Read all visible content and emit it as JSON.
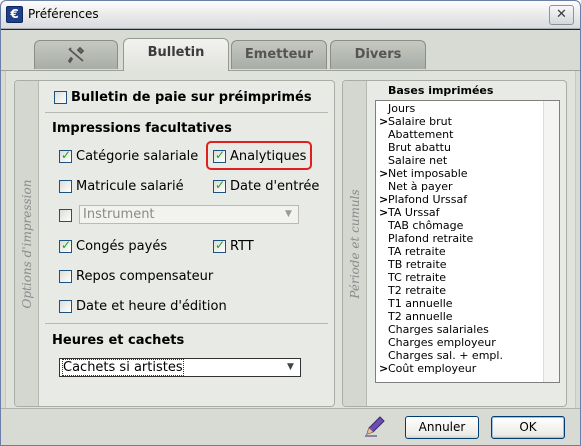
{
  "window": {
    "title": "Préférences",
    "close_glyph": "✕",
    "app_icon_glyph": "€"
  },
  "tabs": [
    {
      "id": "tools",
      "label": "",
      "icon": "tools-icon",
      "active": false
    },
    {
      "id": "bulletin",
      "label": "Bulletin",
      "active": true
    },
    {
      "id": "emetteur",
      "label": "Emetteur",
      "active": false
    },
    {
      "id": "divers",
      "label": "Divers",
      "active": false
    }
  ],
  "options_panel": {
    "side_label": "Options d'impression",
    "preprinted": {
      "label": "Bulletin de paie sur préimprimés",
      "checked": false
    },
    "optional_prints": {
      "title": "Impressions facultatives",
      "categorie_salariale": {
        "label": "Catégorie salariale",
        "checked": true
      },
      "analytiques": {
        "label": "Analytiques",
        "checked": true
      },
      "matricule_salarie": {
        "label": "Matricule salarié",
        "checked": false
      },
      "date_entree": {
        "label": "Date d'entrée",
        "checked": true
      },
      "instrument": {
        "label": "",
        "checked": false,
        "combo_value": "Instrument",
        "enabled": false
      },
      "conges_payes": {
        "label": "Congés payés",
        "checked": true
      },
      "rtt": {
        "label": "RTT",
        "checked": true
      },
      "repos_compensateur": {
        "label": "Repos compensateur",
        "checked": false
      },
      "date_heure_edition": {
        "label": "Date et heure d'édition",
        "checked": false
      }
    },
    "hours": {
      "title": "Heures et cachets",
      "combo_value": "Cachets si artistes"
    }
  },
  "period_panel": {
    "side_label": "Période et cumuls",
    "list_title": "Bases imprimées",
    "items": [
      {
        "label": "Jours",
        "marked": false
      },
      {
        "label": "Salaire brut",
        "marked": true
      },
      {
        "label": "Abattement",
        "marked": false
      },
      {
        "label": "Brut abattu",
        "marked": false
      },
      {
        "label": "Salaire net",
        "marked": false
      },
      {
        "label": "Net imposable",
        "marked": true
      },
      {
        "label": "Net à payer",
        "marked": false
      },
      {
        "label": "Plafond Urssaf",
        "marked": true
      },
      {
        "label": "TA Urssaf",
        "marked": true
      },
      {
        "label": "TAB chômage",
        "marked": false
      },
      {
        "label": "Plafond retraite",
        "marked": false
      },
      {
        "label": "TA retraite",
        "marked": false
      },
      {
        "label": "TB retraite",
        "marked": false
      },
      {
        "label": "TC retraite",
        "marked": false
      },
      {
        "label": "T2 retraite",
        "marked": false
      },
      {
        "label": "T1 annuelle",
        "marked": false
      },
      {
        "label": "T2 annuelle",
        "marked": false
      },
      {
        "label": "Charges salariales",
        "marked": false
      },
      {
        "label": "Charges employeur",
        "marked": false
      },
      {
        "label": "Charges sal. + empl.",
        "marked": false
      },
      {
        "label": "Coût employeur",
        "marked": true
      }
    ],
    "marker_glyph": ">"
  },
  "footer": {
    "cancel_label": "Annuler",
    "ok_label": "OK",
    "edit_icon": "pen-icon"
  },
  "colors": {
    "highlight": "#e02020",
    "check": "#21a121"
  }
}
